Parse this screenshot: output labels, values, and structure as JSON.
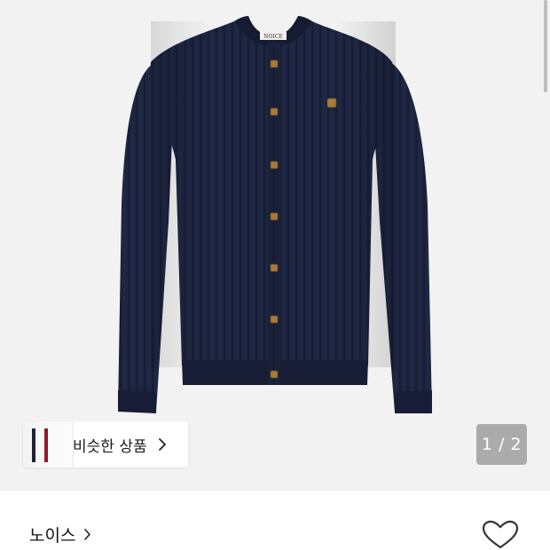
{
  "product": {
    "image_alt": "navy ribbed knit cardigan",
    "label_text": "NOICE"
  },
  "similar": {
    "label": "비슷한 상품",
    "thumb_colors": [
      "#1f2236",
      "#8b1c24",
      "#e9e2d6"
    ]
  },
  "gallery": {
    "counter": "1 / 2"
  },
  "brand": {
    "name": "노이스"
  },
  "colors": {
    "garment": "#1d2540",
    "garment_dark": "#141a30",
    "button": "#a67b3d",
    "background": "#f2f2f2"
  },
  "icons": {
    "chip_chevron": "chevron-right-icon",
    "brand_chevron": "chevron-right-icon",
    "wishlist": "heart-outline-icon"
  }
}
